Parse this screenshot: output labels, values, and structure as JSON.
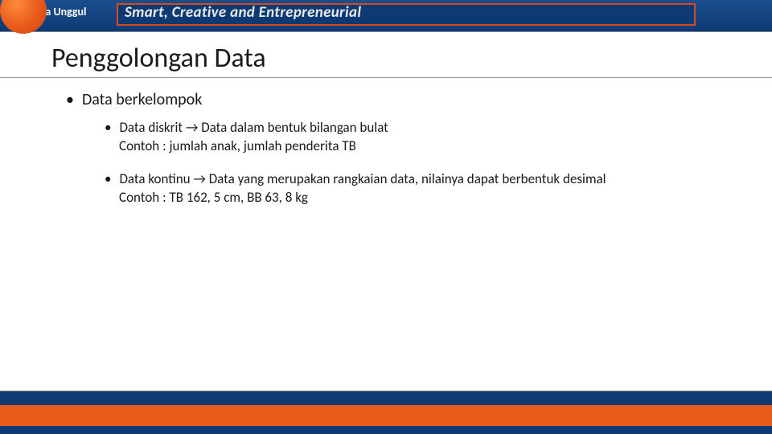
{
  "header": {
    "logo_text": "Esa Unggul",
    "tagline": "Smart, Creative and Entrepreneurial"
  },
  "slide": {
    "title": "Penggolongan Data",
    "bullet1": "Data berkelompok",
    "sub1_line1": "Data diskrit → Data dalam bentuk bilangan bulat",
    "sub1_line2": "Contoh : jumlah anak, jumlah penderita TB",
    "sub2_line1": "Data kontinu → Data yang merupakan rangkaian data, nilainya dapat berbentuk desimal",
    "sub2_line2": "Contoh : TB 162, 5 cm, BB 63, 8 kg"
  }
}
